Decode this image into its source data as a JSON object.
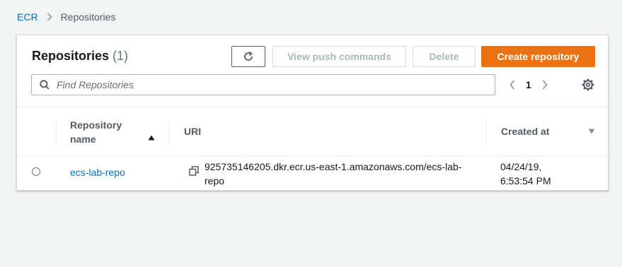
{
  "breadcrumb": {
    "root": "ECR",
    "current": "Repositories"
  },
  "header": {
    "title": "Repositories",
    "count": "(1)",
    "refresh_icon": "refresh-icon",
    "view_push_label": "View push commands",
    "delete_label": "Delete",
    "create_label": "Create repository"
  },
  "search": {
    "placeholder": "Find Repositories",
    "value": ""
  },
  "pagination": {
    "current_page": "1"
  },
  "table": {
    "columns": {
      "name": "Repository name",
      "uri": "URI",
      "created": "Created at"
    },
    "sort": {
      "column": "name",
      "direction": "ascending"
    },
    "rows": [
      {
        "name": "ecs-lab-repo",
        "uri": "925735146205.dkr.ecr.us-east-1.amazonaws.com/ecs-lab-repo",
        "created": "04/24/19, 6:53:54 PM",
        "selected": false
      }
    ]
  },
  "colors": {
    "primary": "#ec7211",
    "link": "#0073bb",
    "background": "#f2f3f3"
  }
}
